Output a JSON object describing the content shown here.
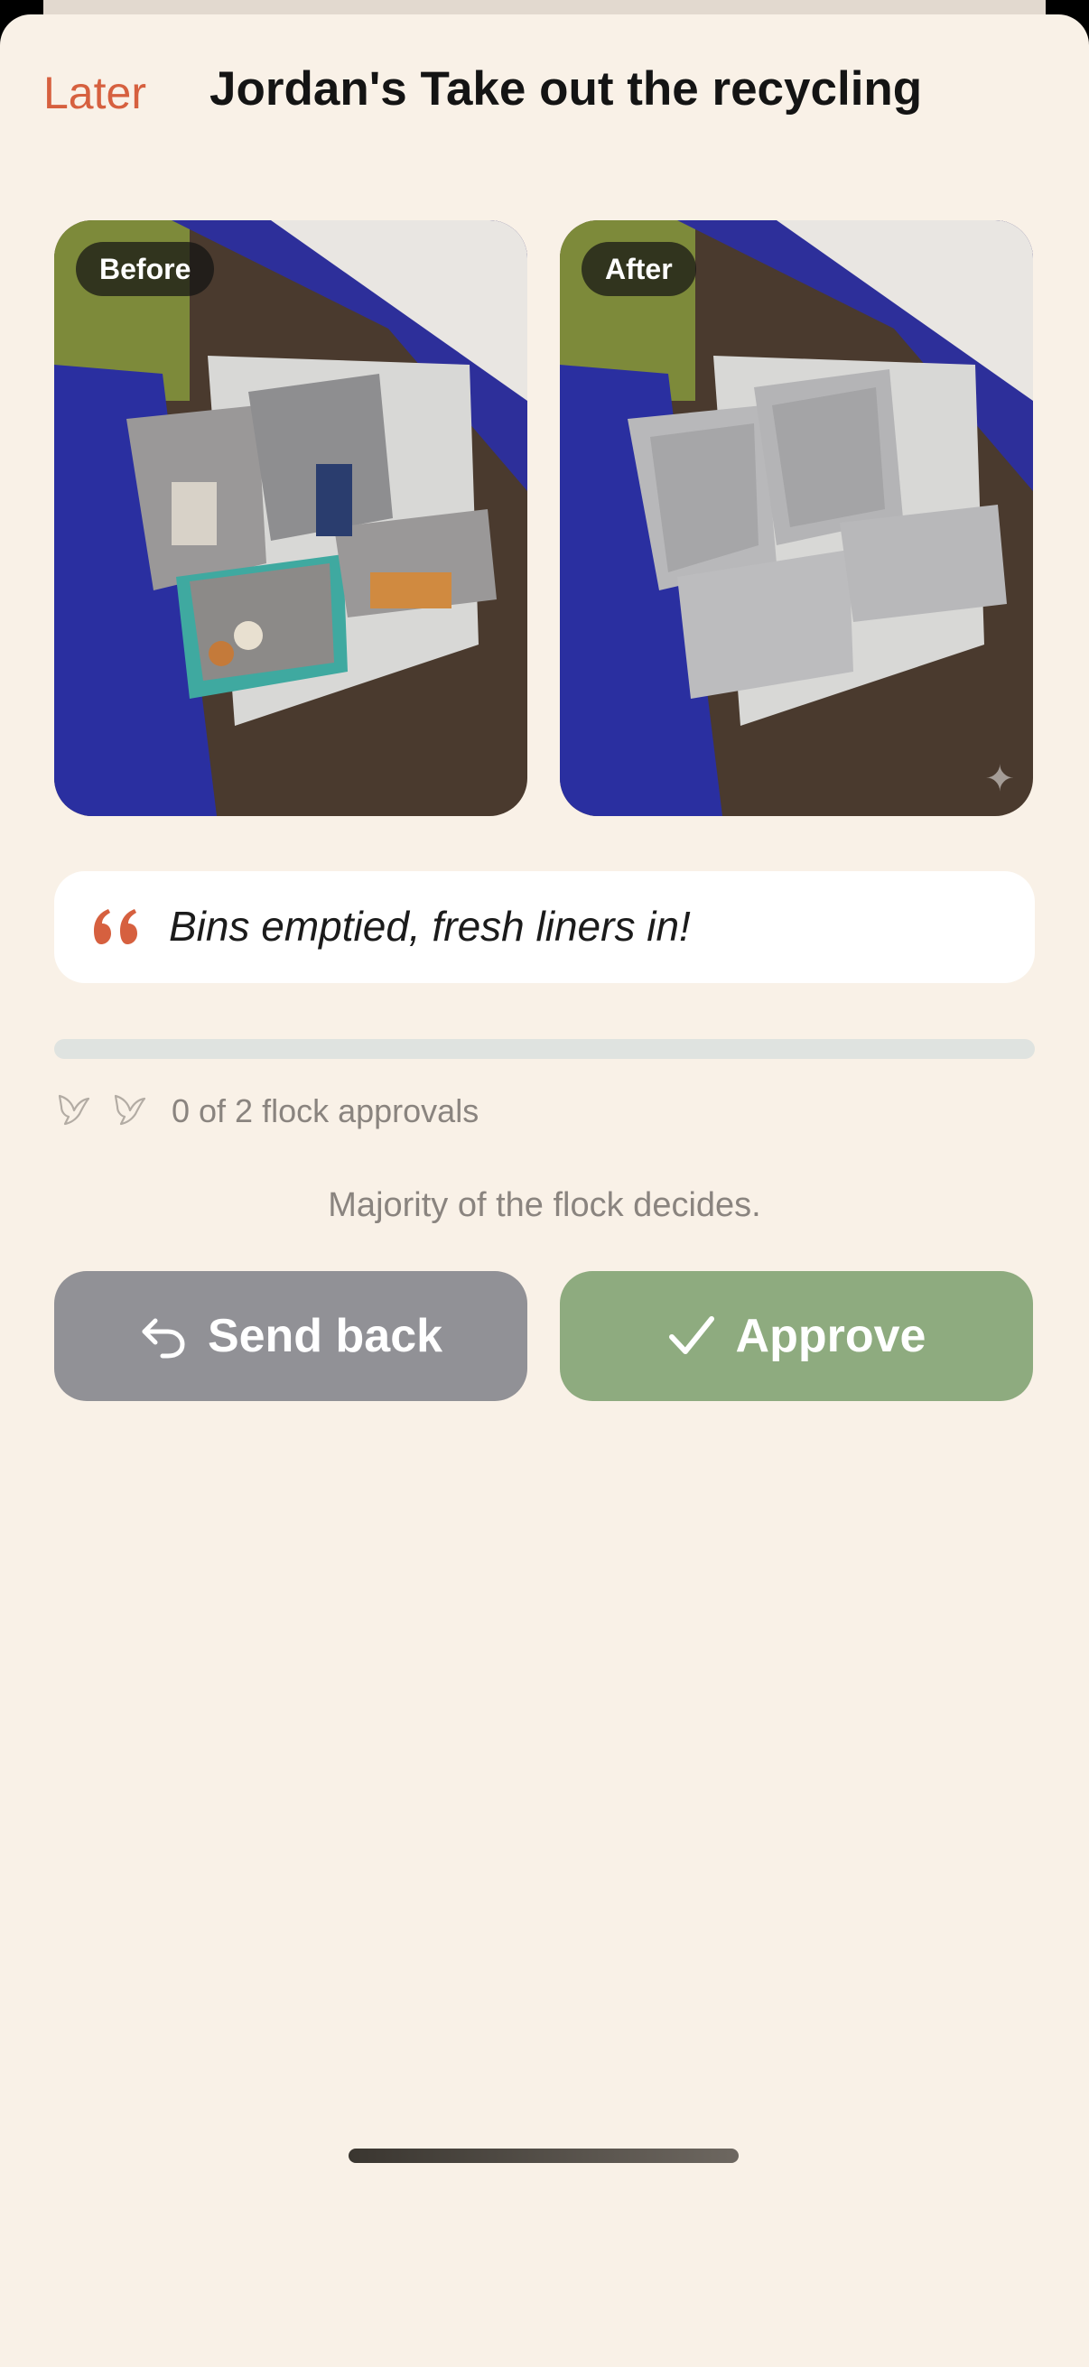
{
  "header": {
    "later_label": "Later",
    "title": "Jordan's Take out the recycling"
  },
  "photos": {
    "before_label": "Before",
    "after_label": "After"
  },
  "comment": {
    "text": "Bins emptied, fresh liners in!"
  },
  "approvals": {
    "count": 0,
    "required": 2,
    "text": "0 of 2 flock approvals",
    "progress": 0
  },
  "rule_text": "Majority of the flock decides.",
  "actions": {
    "send_back_label": "Send back",
    "approve_label": "Approve"
  },
  "colors": {
    "accent": "#d6603f",
    "background": "#f9f1e7",
    "approve": "#8eab7f",
    "send_back": "#919196"
  },
  "icons": {
    "quote": "quote-icon",
    "bird": "bird-icon",
    "undo": "undo-arrow-icon",
    "check": "checkmark-icon"
  }
}
